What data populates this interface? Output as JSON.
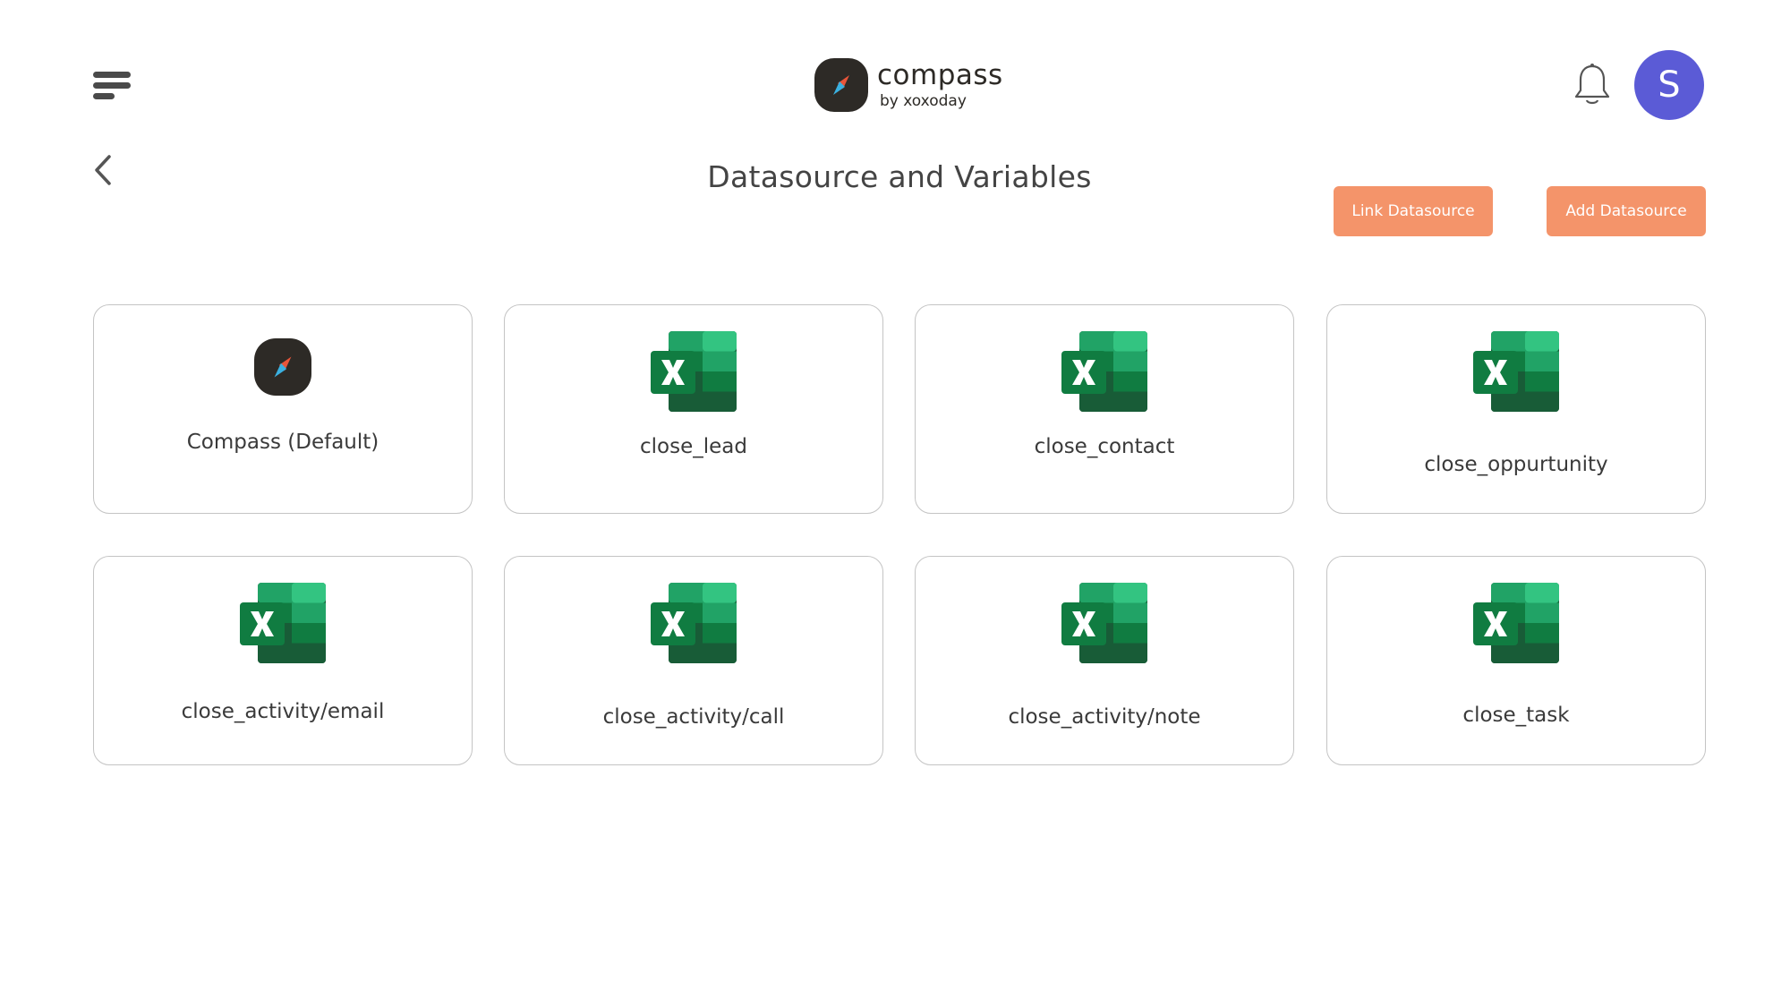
{
  "header": {
    "logo_name": "compass",
    "logo_sub": "by xoxoday",
    "avatar_initial": "S",
    "icons": {
      "menu": "menu-icon",
      "bell": "bell-icon",
      "back": "chevron-left-icon"
    }
  },
  "page": {
    "title": "Datasource and Variables",
    "link_button": "Link Datasource",
    "add_button": "Add Datasource"
  },
  "colors": {
    "accent": "#f4946a",
    "avatar": "#5b5bd6",
    "excel_dark": "#1f6b3a",
    "excel_light": "#33c481"
  },
  "datasources": [
    {
      "label": "Compass (Default)",
      "icon": "compass-logo-icon"
    },
    {
      "label": "close_lead",
      "icon": "excel-icon"
    },
    {
      "label": "close_contact",
      "icon": "excel-icon"
    },
    {
      "label": "close_oppurtunity",
      "icon": "excel-icon"
    },
    {
      "label": "close_activity/email",
      "icon": "excel-icon"
    },
    {
      "label": "close_activity/call",
      "icon": "excel-icon"
    },
    {
      "label": "close_activity/note",
      "icon": "excel-icon"
    },
    {
      "label": "close_task",
      "icon": "excel-icon"
    }
  ]
}
